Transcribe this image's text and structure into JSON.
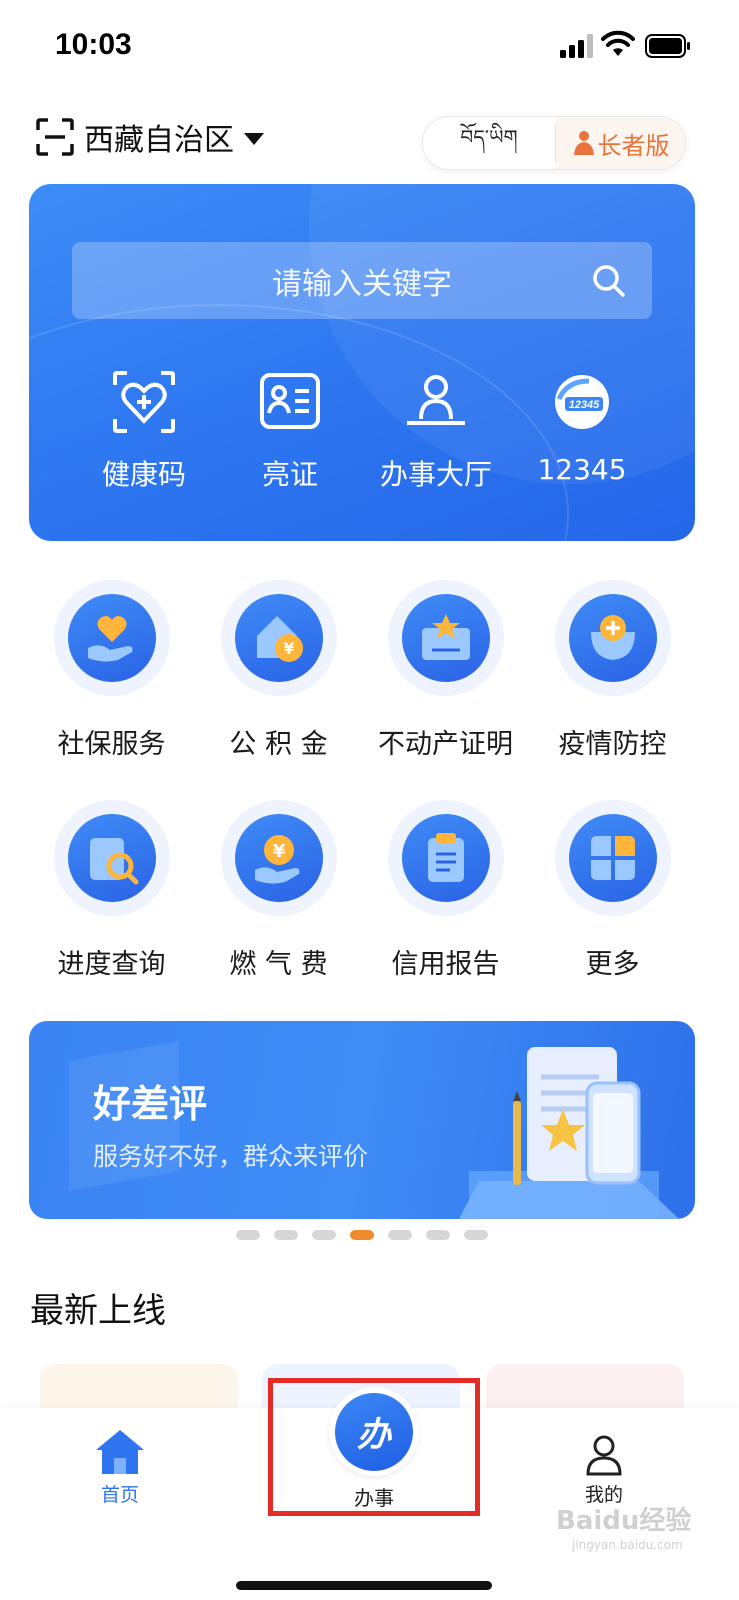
{
  "status_bar": {
    "time": "10:03"
  },
  "header": {
    "location": "西藏自治区",
    "lang_tibetan": "བོད་ཡིག",
    "elder_mode": "长者版"
  },
  "search": {
    "placeholder": "请输入关键字"
  },
  "quick_actions": [
    {
      "label": "健康码",
      "icon": "health-code-icon"
    },
    {
      "label": "亮证",
      "icon": "id-card-icon"
    },
    {
      "label": "办事大厅",
      "icon": "service-hall-icon"
    },
    {
      "label": "12345",
      "icon": "hotline-12345-icon"
    }
  ],
  "services": [
    {
      "label": "社保服务",
      "icon": "social-security-icon"
    },
    {
      "label": "公 积 金",
      "icon": "housing-fund-icon"
    },
    {
      "label": "不动产证明",
      "icon": "property-certificate-icon"
    },
    {
      "label": "疫情防控",
      "icon": "epidemic-control-icon"
    },
    {
      "label": "进度查询",
      "icon": "progress-query-icon"
    },
    {
      "label": "燃 气 费",
      "icon": "gas-fee-icon"
    },
    {
      "label": "信用报告",
      "icon": "credit-report-icon"
    },
    {
      "label": "更多",
      "icon": "more-icon"
    }
  ],
  "banner": {
    "title": "好差评",
    "subtitle": "服务好不好，群众来评价",
    "active_slide": 4,
    "slide_count": 7
  },
  "latest": {
    "title": "最新上线"
  },
  "tab_bar": {
    "home": "首页",
    "center_badge": "办",
    "center": "办事",
    "mine": "我的"
  },
  "watermark": {
    "main": "Baidu经验",
    "sub": "jingyan.baidu.com"
  },
  "colors": {
    "primary": "#2f74f0",
    "accent": "#f08a2c",
    "highlight_box": "#e52b26"
  }
}
